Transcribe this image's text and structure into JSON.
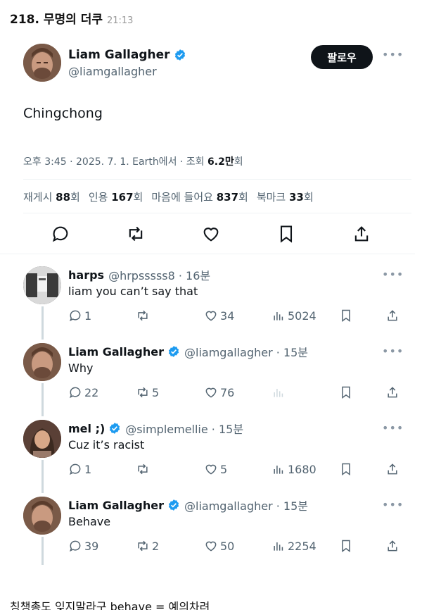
{
  "post": {
    "title": "218. 무명의 더쿠",
    "time": "21:13"
  },
  "tweet": {
    "author_name": "Liam Gallagher",
    "author_handle": "@liamgallagher",
    "follow_label": "팔로우",
    "text": "Chingchong",
    "meta_prefix": "오후 3:45 · 2025. 7. 1. Earth에서 · 조회 ",
    "views": "6.2만",
    "views_suffix": "회",
    "stats": [
      {
        "label": "재게시 ",
        "value": "88",
        "suffix": "회"
      },
      {
        "label": "인용 ",
        "value": "167",
        "suffix": "회"
      },
      {
        "label": "마음에 들어요 ",
        "value": "837",
        "suffix": "회"
      },
      {
        "label": "북마크 ",
        "value": "33",
        "suffix": "회"
      }
    ],
    "more": "•••"
  },
  "replies": [
    {
      "name": "harps",
      "handle": "@hrpsssss8 · 16분",
      "text": "liam you can’t say that",
      "replies": "1",
      "reposts": "",
      "likes": "34",
      "views": "5024",
      "verified": false
    },
    {
      "name": "Liam Gallagher",
      "handle": "@liamgallagher · 15분",
      "text": "Why",
      "replies": "22",
      "reposts": "5",
      "likes": "76",
      "views": "",
      "verified": true
    },
    {
      "name": "mel ;)",
      "handle": "@simplemellie · 15분",
      "text": "Cuz it’s racist",
      "replies": "1",
      "reposts": "",
      "likes": "5",
      "views": "1680",
      "verified": true
    },
    {
      "name": "Liam Gallagher",
      "handle": "@liamgallagher · 15분",
      "text": "Behave",
      "replies": "39",
      "reposts": "2",
      "likes": "50",
      "views": "2254",
      "verified": true
    }
  ],
  "caption": "칭챙총도 잊지말라구 behave = 예의차려",
  "colors": {
    "verified": "#1d9bf0",
    "follow_bg": "#0f1419",
    "muted": "#536471"
  }
}
